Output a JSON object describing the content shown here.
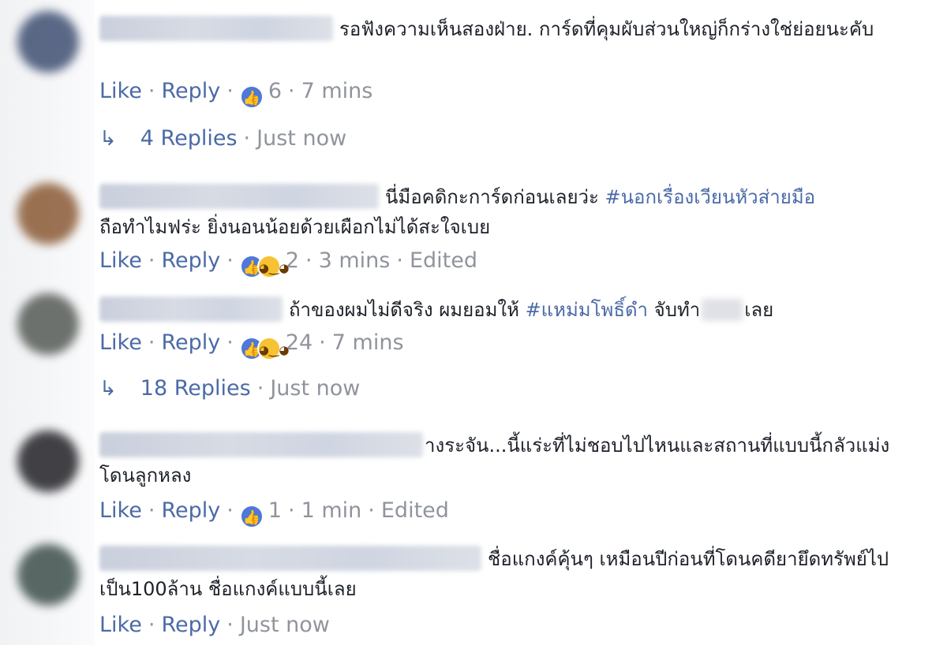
{
  "comments": [
    {
      "text": "รอฟังความเห็นสองฝ่าย. การ์ดที่คุมผับส่วนใหญ่ก็กร่างใช่ย่อยนะคับ",
      "like_label": "Like",
      "reply_label": "Reply",
      "reaction_count": "6",
      "time": "7 mins",
      "replies_label": "4 Replies",
      "replies_time": "Just now",
      "avatar_color": "#3f4f72"
    },
    {
      "text_before": "นี่มือคดิกะการ์ดก่อนเลยว่ะ ",
      "hashtag": "#นอกเรื่องเวียนหัวส่ายมือ",
      "text_line2": "ถือทำไมฟร่ะ ยิ่งนอนน้อยด้วยเผือกไม่ได้สะใจเบย",
      "like_label": "Like",
      "reply_label": "Reply",
      "reaction_count": "2",
      "time": "3 mins",
      "edited": "Edited",
      "avatar_color": "#8a5a35"
    },
    {
      "text_before": "ถ้าของผมไม่ดีจริง ผมยอมให้ ",
      "hashtag": "#แหม่มโพธิ์ดำ",
      "text_after_1": " จับทำ",
      "text_after_2": "เลย",
      "like_label": "Like",
      "reply_label": "Reply",
      "reaction_count": "24",
      "time": "7 mins",
      "replies_label": "18 Replies",
      "replies_time": "Just now",
      "avatar_color": "#555a55"
    },
    {
      "text": "างระจัน...นี้แร่ะที่ไม่ชอบไปไหนและสถานที่แบบนี้กลัวแม่งโดนลูกหลง",
      "like_label": "Like",
      "reply_label": "Reply",
      "reaction_count": "1",
      "time": "1 min",
      "edited": "Edited",
      "avatar_color": "#222226"
    },
    {
      "text": "ชื่อแกงค์คุ้นๆ เหมือนปีก่อนที่โดนคดียายึดทรัพย์ไปเป็น100ล้าน ชื่อแกงค์แบบนี้เลย",
      "like_label": "Like",
      "reply_label": "Reply",
      "time": "Just now",
      "avatar_color": "#3d4f4a"
    }
  ],
  "icons": {
    "like": "thumbs-up-icon",
    "haha": "haha-icon",
    "reply_arrow": "reply-arrow-icon"
  },
  "colors": {
    "link": "#4b6aa7",
    "hashtag": "#365899",
    "meta": "#90949c",
    "like_reaction": "#4e78d9",
    "haha_reaction": "#f7c233"
  }
}
